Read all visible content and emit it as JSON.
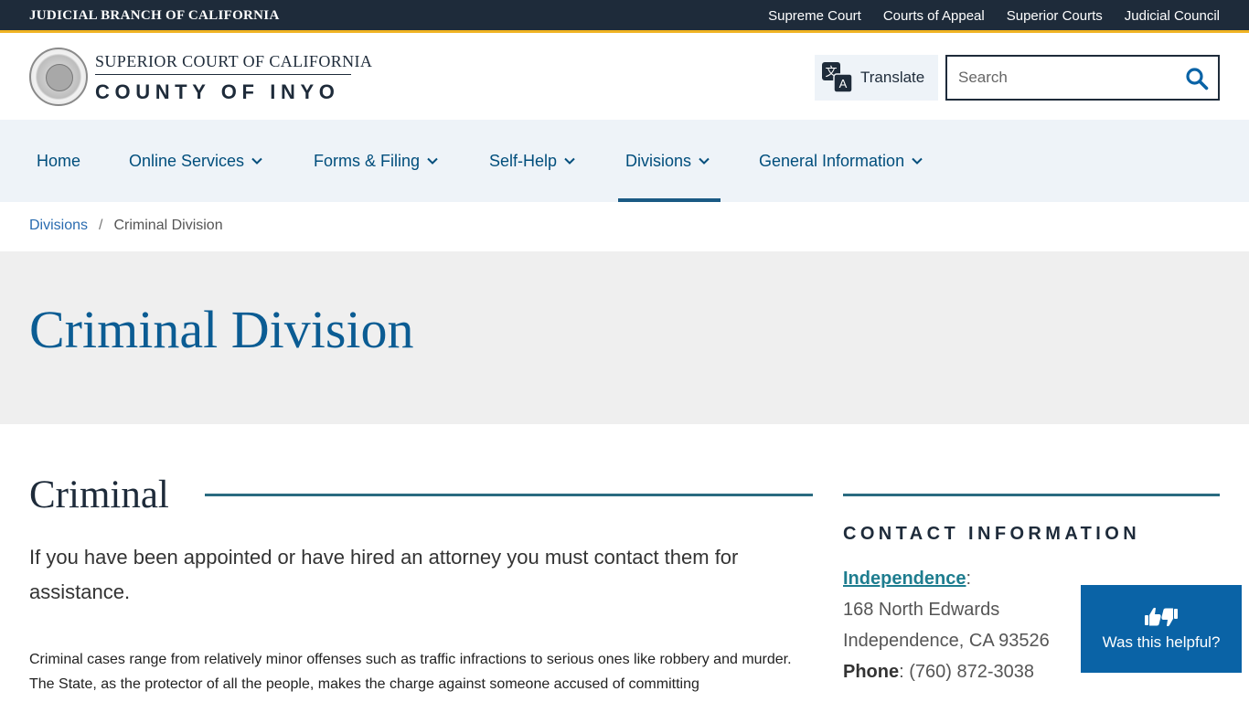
{
  "topbar": {
    "branch": "JUDICIAL BRANCH OF CALIFORNIA",
    "links": [
      "Supreme Court",
      "Courts of Appeal",
      "Superior Courts",
      "Judicial Council"
    ]
  },
  "header": {
    "logo_top": "SUPERIOR COURT OF CALIFORNIA",
    "logo_bottom": "COUNTY OF INYO",
    "translate_label": "Translate",
    "search_placeholder": "Search"
  },
  "nav": {
    "items": [
      {
        "label": "Home"
      },
      {
        "label": "Online Services"
      },
      {
        "label": "Forms & Filing"
      },
      {
        "label": "Self-Help"
      },
      {
        "label": "Divisions"
      },
      {
        "label": "General Information"
      }
    ],
    "active": "Divisions"
  },
  "breadcrumb": {
    "parent": "Divisions",
    "separator": "/",
    "current": "Criminal Division"
  },
  "hero": {
    "title": "Criminal Division"
  },
  "content": {
    "section_title": "Criminal",
    "lead": "If you have been appointed or have hired an attorney you must contact them for assistance.",
    "body": "Criminal cases range from relatively minor offenses such as traffic infractions to serious ones like robbery and murder. The State, as the protector of all the people, makes the charge against someone accused of committing"
  },
  "sidebar": {
    "heading": "CONTACT INFORMATION",
    "location": "Independence",
    "address1": "168 North Edwards",
    "address2": "Independence, CA 93526",
    "phone_label": "Phone",
    "phone": "(760) 872-3038"
  },
  "feedback": {
    "label": "Was this helpful?"
  },
  "colors": {
    "topbar": "#1e2b3a",
    "accent_gold": "#f0b323",
    "nav_bg": "#eef3f8",
    "link_blue": "#004e7c",
    "hero_title": "#0b5c93",
    "feedback_bg": "#0a63a6"
  }
}
